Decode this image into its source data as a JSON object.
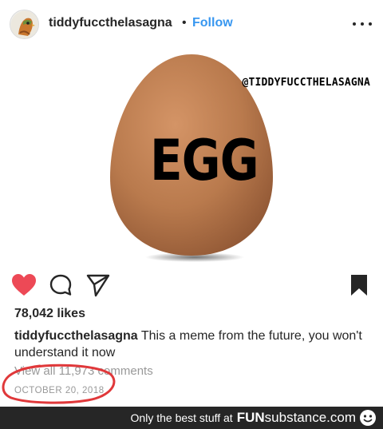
{
  "header": {
    "username": "tiddyfuccthelasagna",
    "separator": "•",
    "follow_label": "Follow",
    "avatar_icon": "profile-avatar-icon",
    "more_icon": "more-options-icon"
  },
  "post_image": {
    "watermark": "@TIDDYFUCCTHELASAGNA",
    "egg_text": "EGG",
    "egg_color": "#b97a4d"
  },
  "actions": {
    "like_icon": "heart-icon",
    "comment_icon": "comment-icon",
    "share_icon": "paper-plane-icon",
    "save_icon": "bookmark-icon",
    "like_color": "#ed4956"
  },
  "likes": "78,042 likes",
  "caption": {
    "username": "tiddyfuccthelasagna",
    "text": "This a meme from the future, you won't understand it now"
  },
  "view_comments": "View all 11,973 comments",
  "date": "OCTOBER 20, 2018",
  "annotation_color": "#e0383a",
  "footer": {
    "text": "Only the best stuff at",
    "brand_bold": "FUN",
    "brand_rest": "substance",
    "brand_suffix": ".com"
  }
}
